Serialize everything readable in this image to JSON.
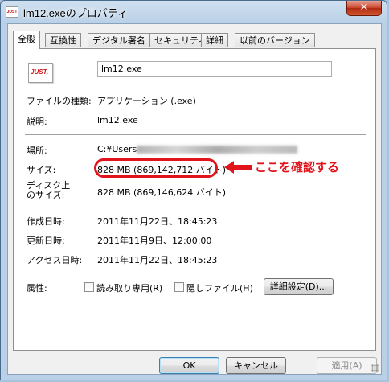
{
  "window": {
    "title": "lm12.exeのプロパティ",
    "app_icon_text": "JUST",
    "close_glyph": "✕"
  },
  "tabs": [
    "全般",
    "互換性",
    "デジタル署名",
    "セキュリティ",
    "詳細",
    "以前のバージョン"
  ],
  "file": {
    "icon_text": "JUST.",
    "name": "lm12.exe"
  },
  "rows": {
    "type_label": "ファイルの種類:",
    "type_value": "アプリケーション (.exe)",
    "desc_label": "説明:",
    "desc_value": "lm12.exe",
    "location_label": "場所:",
    "location_value": "C:¥Users",
    "size_label": "サイズ:",
    "size_value": "828 MB (869,142,712 バイト)",
    "disk_size_label_1": "ディスク上",
    "disk_size_label_2": "のサイズ:",
    "disk_size_value": "828 MB (869,146,624 バイト)",
    "created_label": "作成日時:",
    "created_value": "2011年11月22日、18:45:23",
    "modified_label": "更新日時:",
    "modified_value": "2011年11月9日、12:00:00",
    "accessed_label": "アクセス日時:",
    "accessed_value": "2011年11月22日、18:45:23",
    "attributes_label": "属性:"
  },
  "attributes": {
    "readonly_label": "読み取り専用(R)",
    "hidden_label": "隠しファイル(H)",
    "advanced_button": "詳細設定(D)..."
  },
  "annotation": {
    "text": "ここを確認する",
    "color": "#e0141a"
  },
  "buttons": {
    "ok": "OK",
    "cancel": "キャンセル",
    "apply": "適用(A)"
  }
}
